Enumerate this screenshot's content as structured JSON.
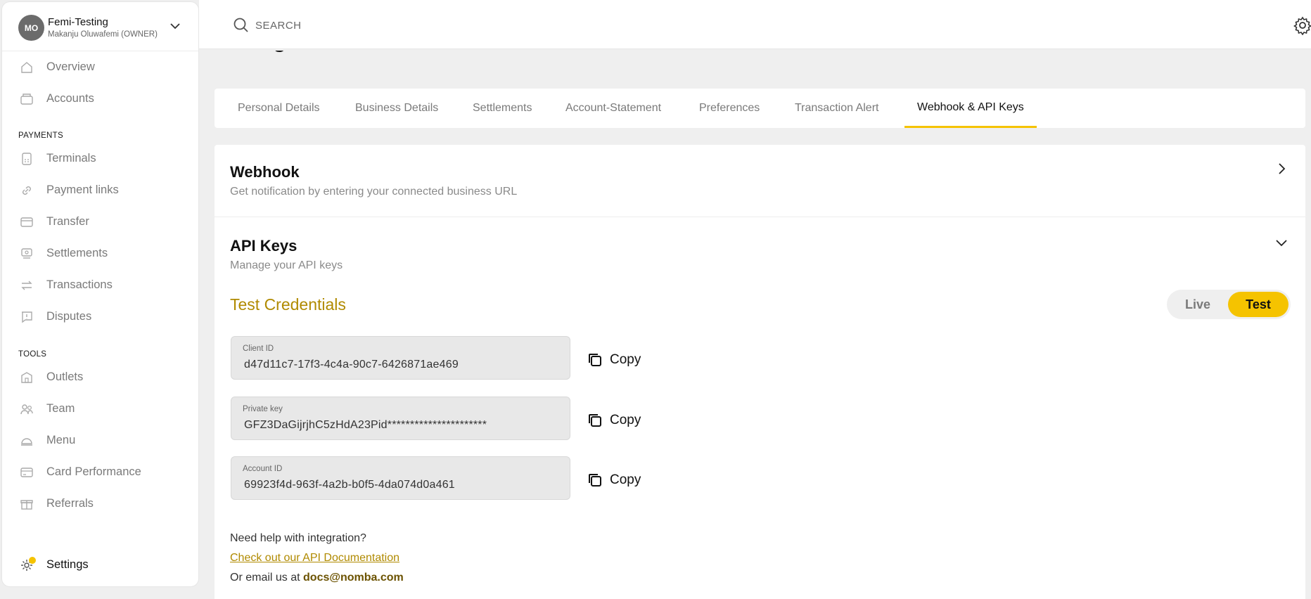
{
  "org": {
    "initials": "MO",
    "name": "Femi-Testing",
    "owner": "Makanju Oluwafemi (OWNER)"
  },
  "nav": {
    "top": [
      {
        "label": "Overview",
        "icon": "home-icon"
      },
      {
        "label": "Accounts",
        "icon": "wallet-icon"
      }
    ],
    "payments_heading": "PAYMENTS",
    "payments": [
      {
        "label": "Terminals",
        "icon": "terminal-icon"
      },
      {
        "label": "Payment links",
        "icon": "link-icon"
      },
      {
        "label": "Transfer",
        "icon": "transfer-icon"
      },
      {
        "label": "Settlements",
        "icon": "settlements-icon"
      },
      {
        "label": "Transactions",
        "icon": "transactions-icon"
      },
      {
        "label": "Disputes",
        "icon": "disputes-icon"
      }
    ],
    "tools_heading": "TOOLS",
    "tools": [
      {
        "label": "Outlets",
        "icon": "outlets-icon"
      },
      {
        "label": "Team",
        "icon": "team-icon"
      },
      {
        "label": "Menu",
        "icon": "menu-icon"
      },
      {
        "label": "Card Performance",
        "icon": "card-icon"
      },
      {
        "label": "Referrals",
        "icon": "gift-icon"
      }
    ],
    "settings": {
      "label": "Settings",
      "icon": "gear-icon"
    }
  },
  "search": {
    "placeholder": "SEARCH"
  },
  "page": {
    "title": "Settings"
  },
  "tabs": [
    {
      "label": "Personal Details"
    },
    {
      "label": "Business Details"
    },
    {
      "label": "Settlements"
    },
    {
      "label": "Account-Statement"
    },
    {
      "label": "Preferences"
    },
    {
      "label": "Transaction Alert"
    },
    {
      "label": "Webhook & API Keys",
      "active": true
    }
  ],
  "webhook": {
    "title": "Webhook",
    "subtitle": "Get notification by entering your connected business URL"
  },
  "api_keys": {
    "title": "API Keys",
    "subtitle": "Manage your API keys",
    "credentials_title": "Test Credentials",
    "toggle": {
      "live": "Live",
      "test": "Test",
      "selected": "Test"
    },
    "fields": [
      {
        "label": "Client ID",
        "value": "d47d11c7-17f3-4c4a-90c7-6426871ae469",
        "copy": "Copy"
      },
      {
        "label": "Private key",
        "value": "GFZ3DaGijrjhC5zHdA23Pid**********************",
        "copy": "Copy"
      },
      {
        "label": "Account ID",
        "value": "69923f4d-963f-4a2b-b0f5-4da074d0a461",
        "copy": "Copy"
      }
    ]
  },
  "help": {
    "question": "Need help with integration?",
    "link": "Check out our API Documentation",
    "email_prefix": "Or email us at ",
    "email": "docs@nomba.com"
  },
  "colors": {
    "accent": "#f5c300",
    "credential_title": "#b08a00"
  }
}
